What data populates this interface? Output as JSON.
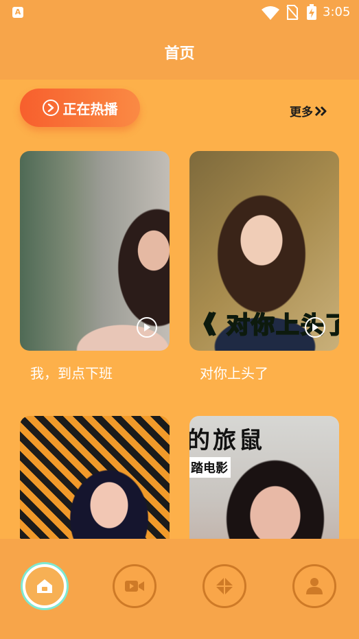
{
  "status_bar": {
    "app_badge": "A",
    "time": "3:05",
    "icons": [
      "wifi-icon",
      "no-sim-icon",
      "battery-charging-icon"
    ]
  },
  "header": {
    "title": "首页"
  },
  "section": {
    "hot_label": "正在热播",
    "more_label": "更多"
  },
  "videos": [
    {
      "title": "我，到点下班",
      "overlay_text": ""
    },
    {
      "title": "对你上头了",
      "overlay_text": "《 对你上头了"
    },
    {
      "title": "",
      "overlay_text": ""
    },
    {
      "title": "",
      "overlay_text": "的旅鼠",
      "overlay_sub": "踏电影"
    }
  ],
  "bottom_nav": {
    "items": [
      {
        "name": "home",
        "icon": "home-icon",
        "active": true
      },
      {
        "name": "video",
        "icon": "video-camera-icon",
        "active": false
      },
      {
        "name": "discover",
        "icon": "diamond-icon",
        "active": false
      },
      {
        "name": "profile",
        "icon": "user-icon",
        "active": false
      }
    ]
  },
  "colors": {
    "background": "#fdb04a",
    "header": "#f7a54a",
    "hot_button_start": "#f75f2d",
    "hot_button_end": "#fa8a44",
    "overlay_green": "#4fe043",
    "nav_ring": "#ce7a27",
    "active_glow": "#7ee8d0"
  }
}
